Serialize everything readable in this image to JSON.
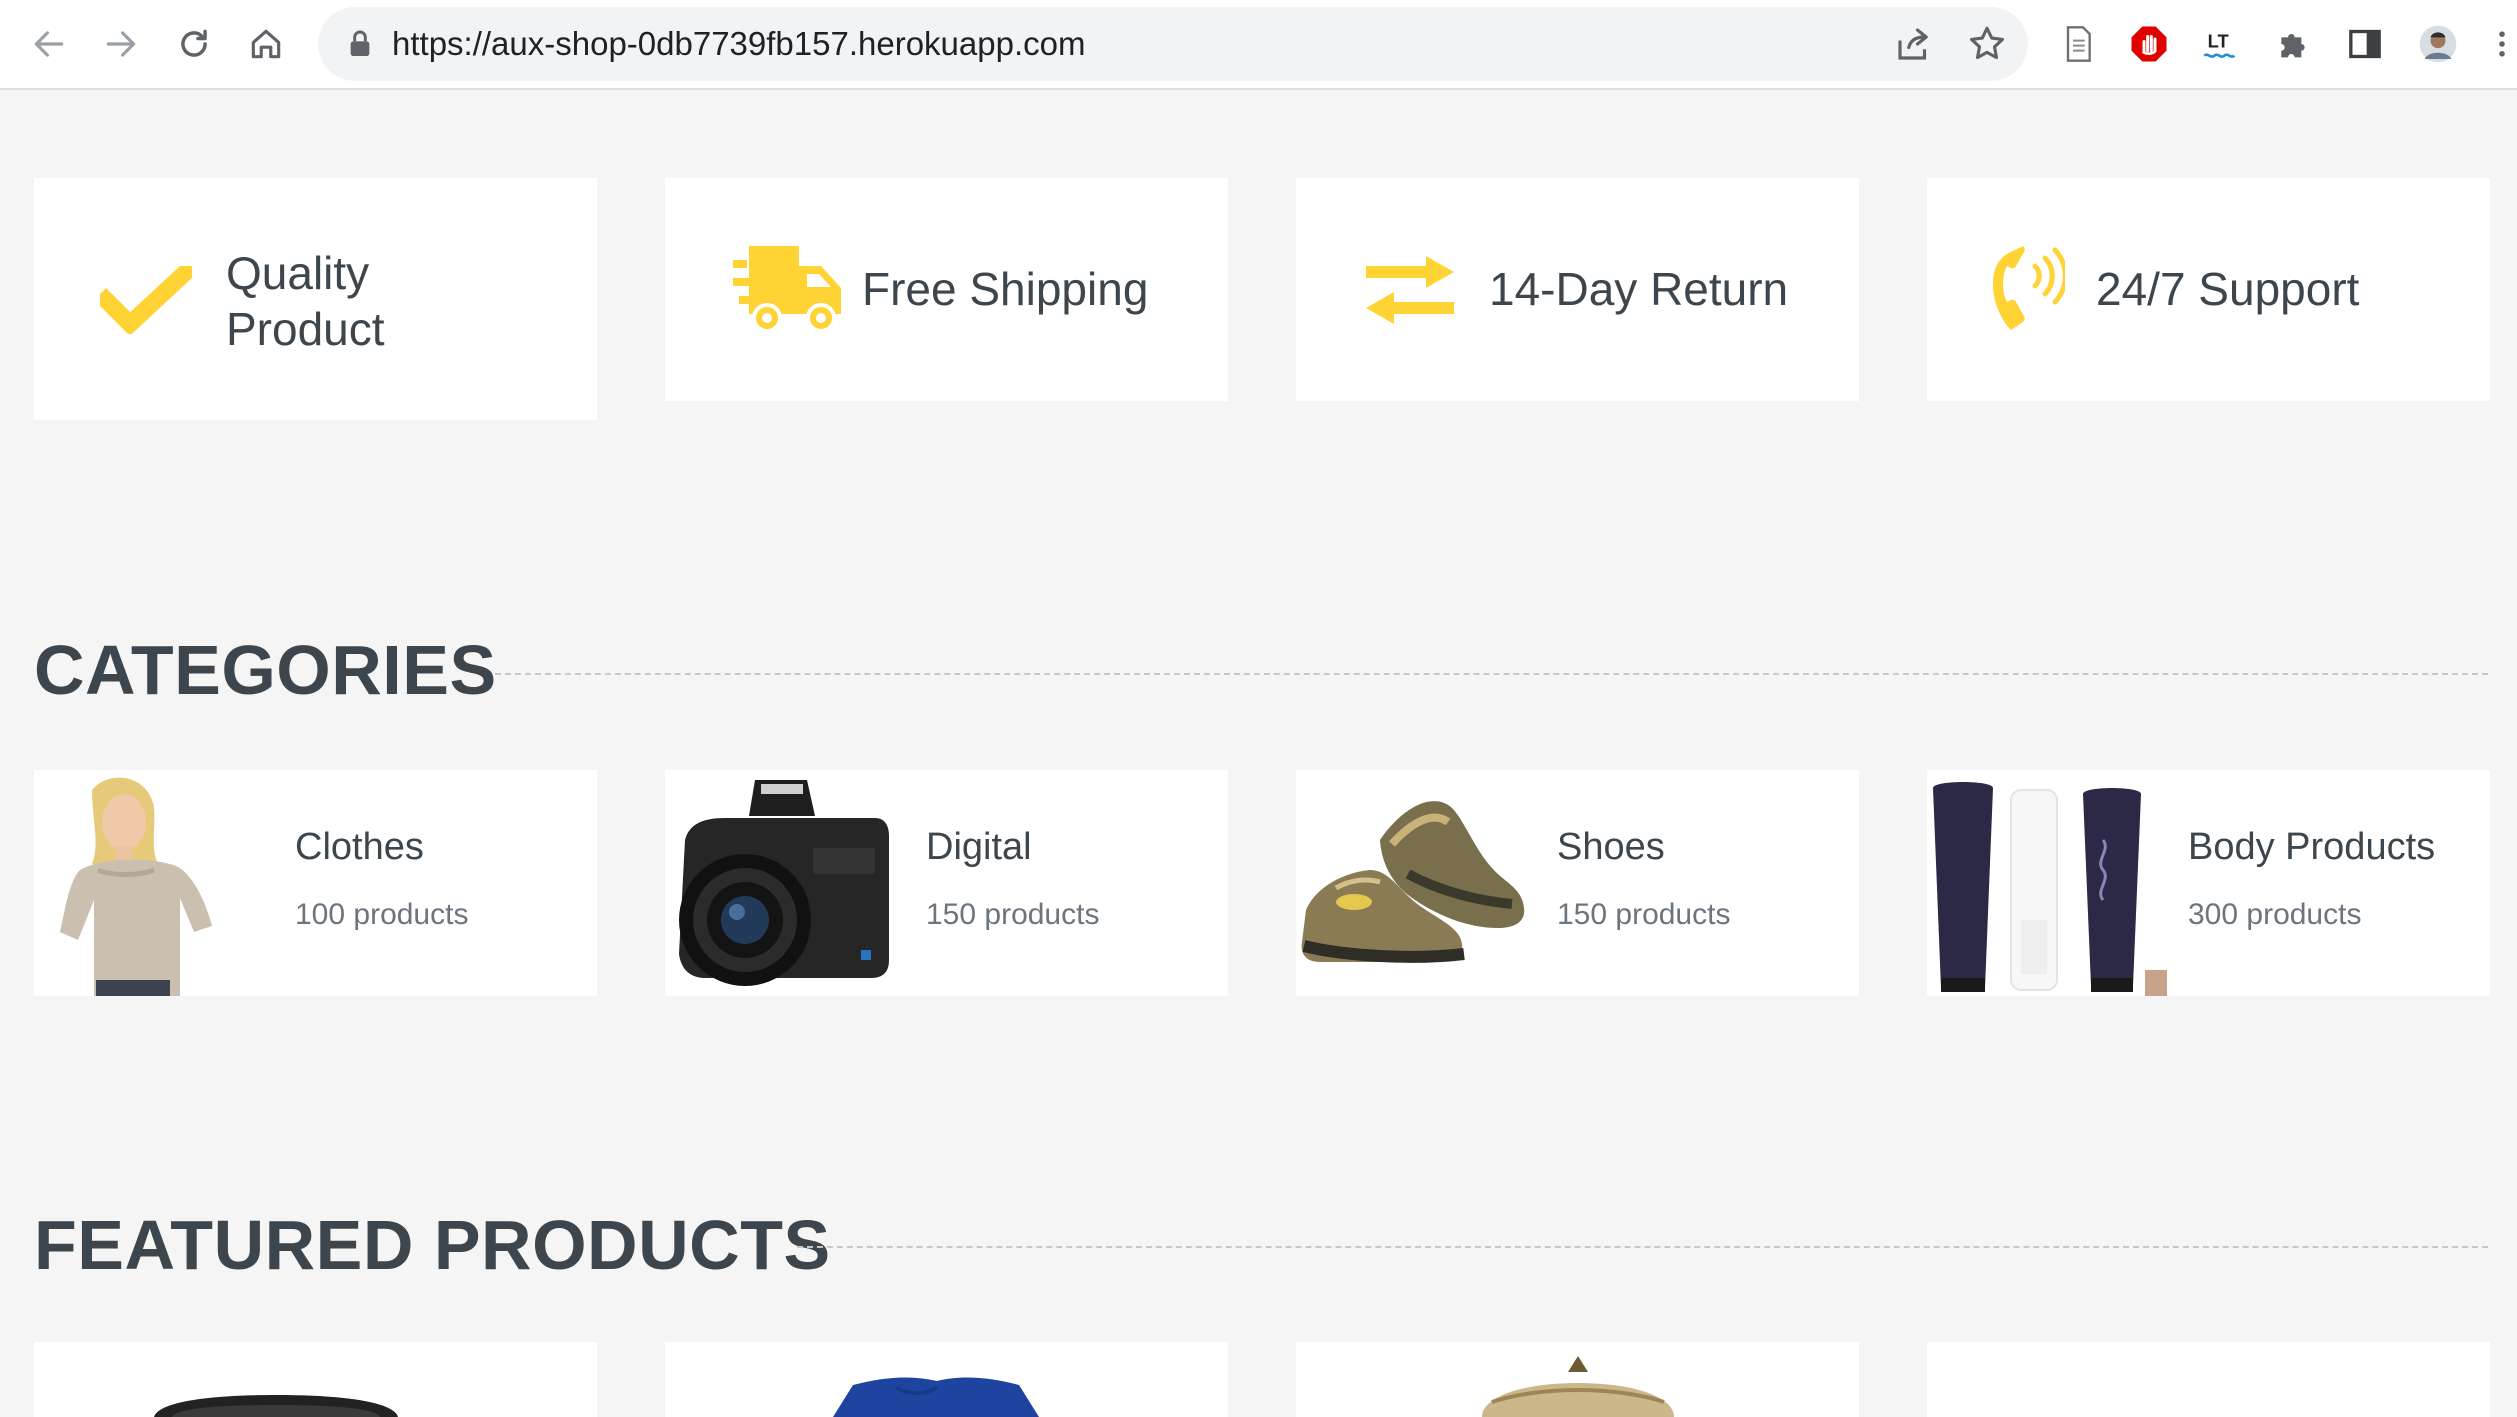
{
  "browser": {
    "url": "https://aux-shop-0db7739fb157.herokuapp.com"
  },
  "features": [
    {
      "line1": "Quality",
      "line2": "Product",
      "icon": "check-icon"
    },
    {
      "label": "Free Shipping",
      "icon": "truck-icon"
    },
    {
      "label": "14-Day Return",
      "icon": "exchange-icon"
    },
    {
      "label": "24/7 Support",
      "icon": "phone-icon"
    }
  ],
  "sections": {
    "categories_title": "CATEGORIES",
    "featured_title": "FEATURED PRODUCTS"
  },
  "categories": [
    {
      "name": "Clothes",
      "count": "100 products"
    },
    {
      "name": "Digital",
      "count": "150 products"
    },
    {
      "name": "Shoes",
      "count": "150 products"
    },
    {
      "name": "Body Products",
      "count": "300 products"
    }
  ],
  "colors": {
    "accent": "#FFD333",
    "text": "#3D464D",
    "muted": "#6C757D",
    "background": "#F5F5F5"
  }
}
